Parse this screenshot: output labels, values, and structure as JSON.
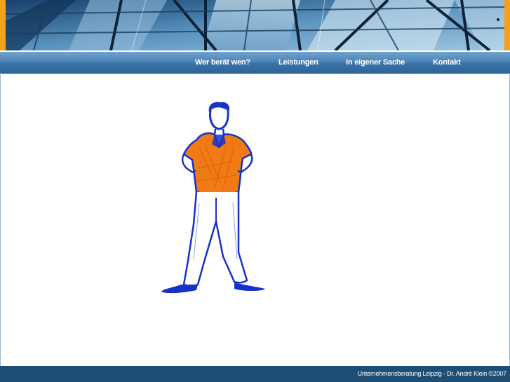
{
  "navigation": {
    "items": [
      {
        "label": "Wer berät wen?"
      },
      {
        "label": "Leistungen"
      },
      {
        "label": "In eigener Sache"
      },
      {
        "label": "Kontakt"
      }
    ]
  },
  "footer": {
    "text": "Unternehmensberatung Leipzig - Dr. André Klein  ©2007"
  },
  "colors": {
    "banner_accent": "#f3a21a",
    "nav_bar": "#4f86b8",
    "footer_bar": "#1d4f76",
    "figure_shirt": "#f07a14",
    "figure_outline": "#1633c8"
  }
}
